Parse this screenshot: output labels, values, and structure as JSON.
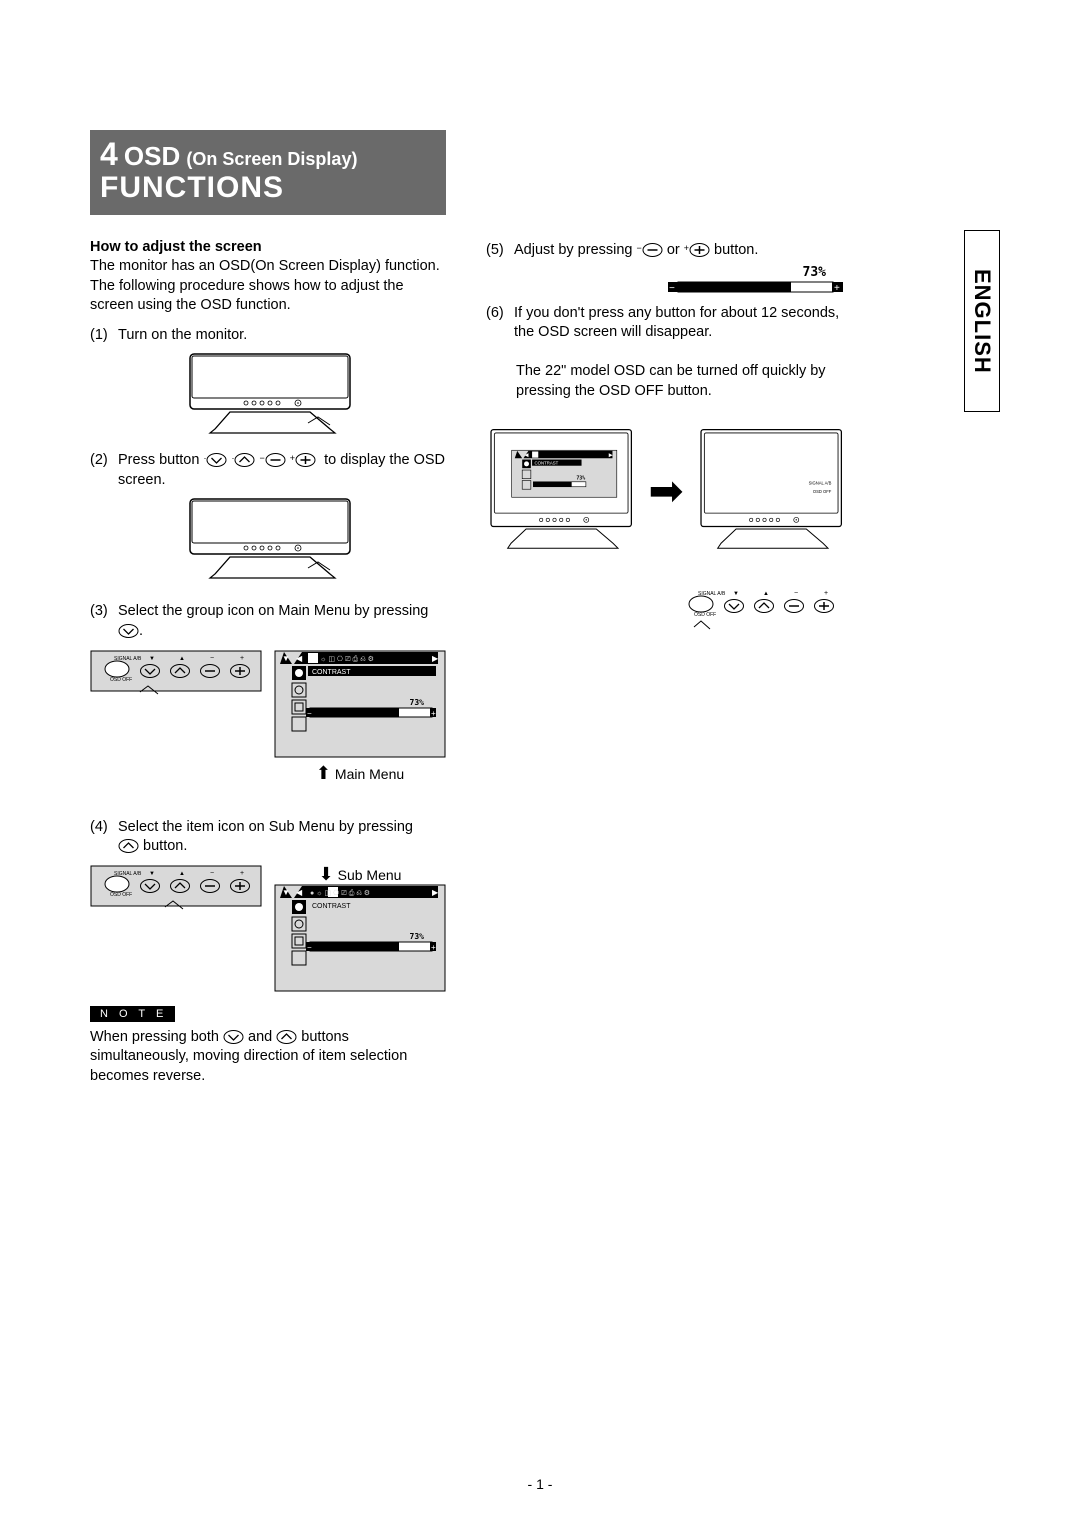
{
  "header": {
    "chapter_number": "4",
    "title_osd": "OSD",
    "title_paren": "(On Screen Display)",
    "title_functions": "FUNCTIONS"
  },
  "left": {
    "subhead": "How to adjust the screen",
    "intro": "The monitor has an OSD(On Screen Display) function. The following procedure shows how to adjust the screen using the OSD function.",
    "step1": "Turn on the monitor.",
    "step2_a": "Press button ",
    "step2_b": "to display the OSD screen.",
    "step3_a": "Select the group icon on Main Menu by pressing ",
    "step3_b": ".",
    "step4_a": "Select the item icon on Sub Menu by pressing",
    "step4_b": " button.",
    "main_menu_label": "Main Menu",
    "sub_menu_label": "Sub Menu",
    "note_label": "N O T E",
    "note_text_a": "When pressing both ",
    "note_text_b": " and ",
    "note_text_c": " buttons simultaneously, moving direction of item selection becomes reverse.",
    "osd_item_label": "CONTRAST",
    "osd_value": "73%",
    "signal_label": "SIGNAL A/B",
    "osdoff_label": "OSD OFF"
  },
  "right": {
    "step5_a": "Adjust by pressing ",
    "step5_b": " or ",
    "step5_c": " button.",
    "slider_value": "73%",
    "step6_a": "If you don't press any button for about 12 seconds, the OSD screen will disappear.",
    "step6_b": "The 22\" model OSD can be turned off quickly by pressing the OSD OFF  button."
  },
  "lang_tab": "ENGLISH",
  "page_number": "- 1 -"
}
